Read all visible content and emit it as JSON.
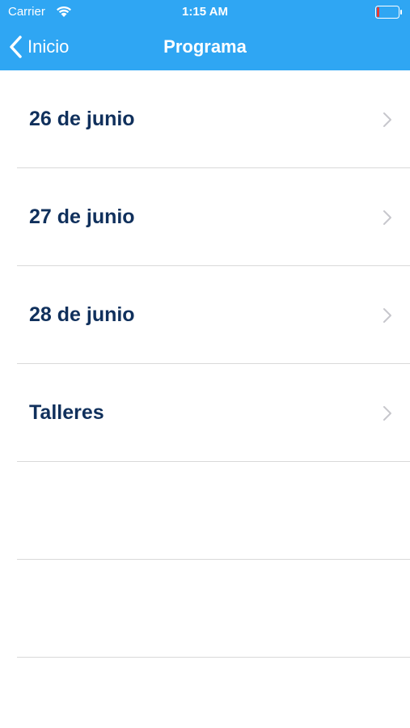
{
  "status_bar": {
    "carrier": "Carrier",
    "time": "1:15 AM",
    "wifi_icon": "wifi-icon",
    "battery_icon": "battery-low-icon"
  },
  "nav_bar": {
    "back_label": "Inicio",
    "title": "Programa",
    "color": "#2fa6f3"
  },
  "list": {
    "items": [
      {
        "label": "26 de junio"
      },
      {
        "label": "27 de junio"
      },
      {
        "label": "28 de junio"
      },
      {
        "label": "Talleres"
      }
    ],
    "text_color": "#10305c"
  }
}
